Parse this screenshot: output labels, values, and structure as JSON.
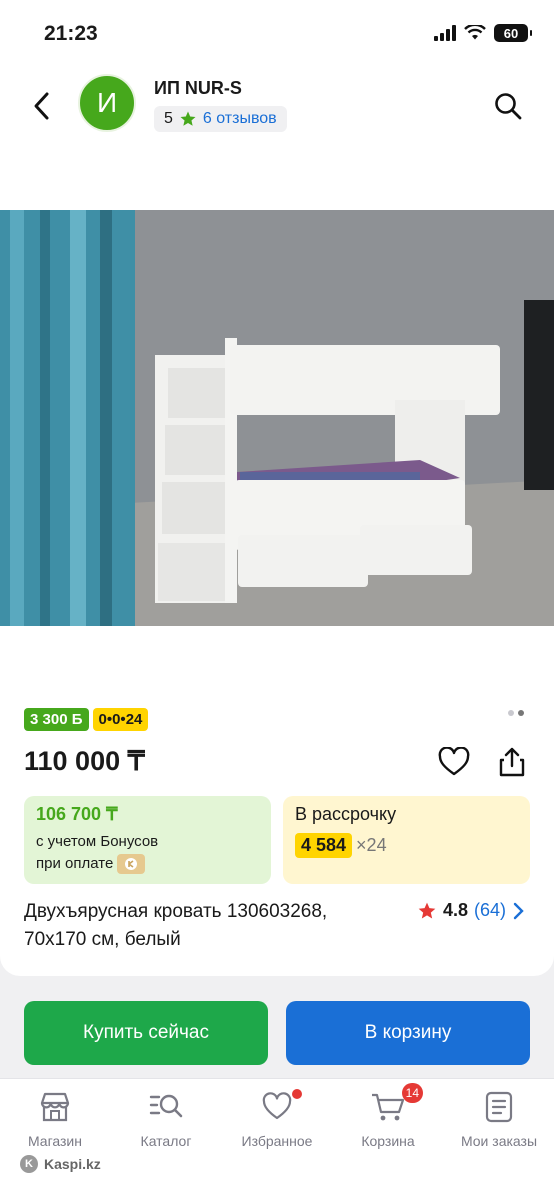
{
  "status": {
    "time": "21:23",
    "battery": "60"
  },
  "header": {
    "avatar_letter": "И",
    "shop_name": "ИП NUR-S",
    "rating": "5",
    "reviews": "6 отзывов"
  },
  "badges": {
    "bonus": "3 300 Б",
    "installment": "0•0•24"
  },
  "gallery": {
    "current": 2,
    "total": 2
  },
  "product": {
    "price": "110 000 ₸",
    "bonus_price": "106 700 ₸",
    "bonus_text_1": "с учетом Бонусов",
    "bonus_text_2": "при оплате",
    "installment_label": "В рассрочку",
    "installment_amount": "4 584",
    "installment_months": "×24",
    "title": "Двухъярусная кровать 130603268, 70х170 см, белый",
    "rating_value": "4.8",
    "rating_count": "(64)"
  },
  "actions": {
    "buy_now": "Купить сейчас",
    "add_to_cart": "В корзину"
  },
  "tabbar": {
    "items": [
      {
        "label": "Магазин",
        "icon": "store-icon"
      },
      {
        "label": "Каталог",
        "icon": "catalog-search-icon"
      },
      {
        "label": "Избранное",
        "icon": "heart-icon"
      },
      {
        "label": "Корзина",
        "icon": "cart-icon"
      },
      {
        "label": "Мои заказы",
        "icon": "orders-icon"
      }
    ],
    "cart_count": "14",
    "brand": "Kaspi.kz"
  },
  "colors": {
    "green": "#46a81c",
    "blue": "#1a6fd6",
    "yellow": "#ffd400",
    "buy_green": "#1ea84a"
  }
}
